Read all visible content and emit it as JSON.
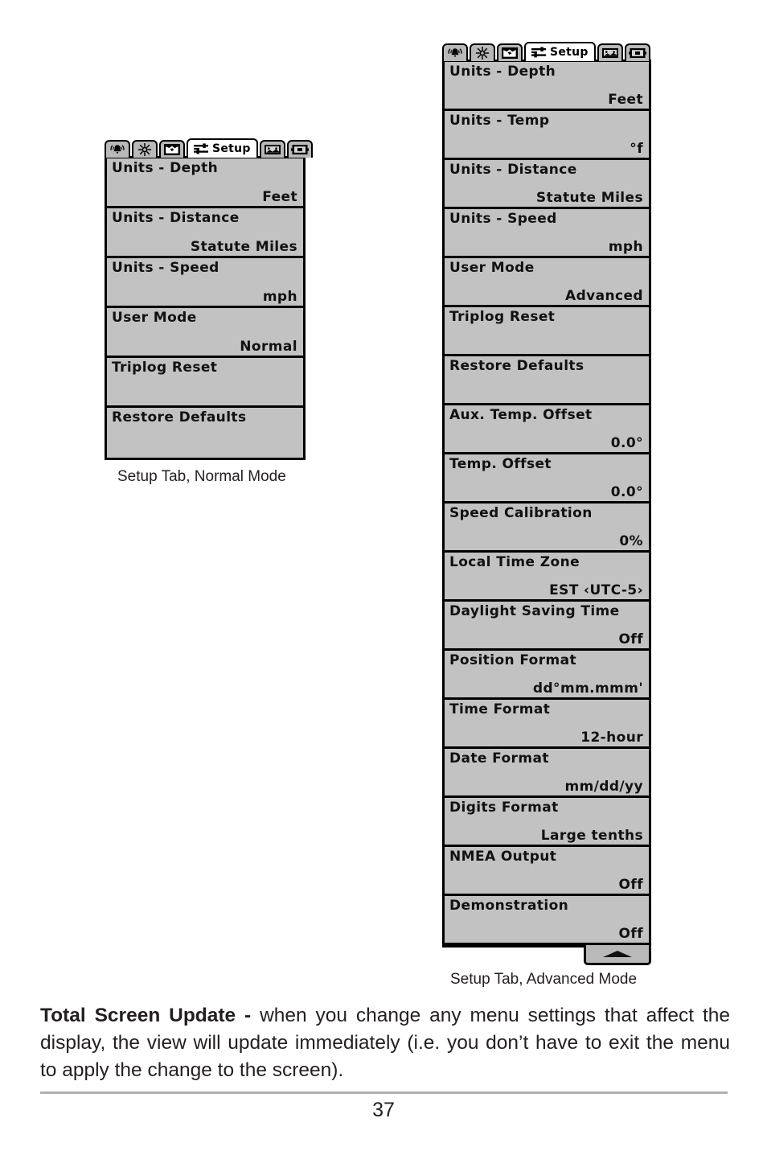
{
  "tab_bar": {
    "tabs": [
      {
        "icon": "alarm-bell-icon",
        "label": "",
        "active": false
      },
      {
        "icon": "sonar-starburst-icon",
        "label": "",
        "active": false
      },
      {
        "icon": "navigation-map-icon",
        "label": "",
        "active": false
      },
      {
        "icon": "setup-sliders-icon",
        "label": "Setup",
        "active": true
      },
      {
        "icon": "views-chart-icon",
        "label": "",
        "active": false
      },
      {
        "icon": "accessories-box-icon",
        "label": "",
        "active": false
      }
    ]
  },
  "normal_panel": {
    "caption": "Setup Tab, Normal Mode",
    "rows": [
      {
        "label": "Units - Depth",
        "value": "Feet"
      },
      {
        "label": "Units - Distance",
        "value": "Statute Miles"
      },
      {
        "label": "Units - Speed",
        "value": "mph"
      },
      {
        "label": "User Mode",
        "value": "Normal"
      },
      {
        "label": "Triplog Reset",
        "value": ""
      },
      {
        "label": "Restore Defaults",
        "value": ""
      }
    ]
  },
  "advanced_panel": {
    "caption": "Setup Tab, Advanced Mode",
    "scroll_indicator": "scroll-up-arrow-icon",
    "rows": [
      {
        "label": "Units - Depth",
        "value": "Feet"
      },
      {
        "label": "Units - Temp",
        "value": "°f"
      },
      {
        "label": "Units - Distance",
        "value": "Statute Miles"
      },
      {
        "label": "Units - Speed",
        "value": "mph"
      },
      {
        "label": "User Mode",
        "value": "Advanced"
      },
      {
        "label": "Triplog Reset",
        "value": ""
      },
      {
        "label": "Restore Defaults",
        "value": ""
      },
      {
        "label": "Aux. Temp. Offset",
        "value": "0.0°"
      },
      {
        "label": "Temp. Offset",
        "value": "0.0°"
      },
      {
        "label": "Speed Calibration",
        "value": "0%"
      },
      {
        "label": "Local Time Zone",
        "value": "EST ‹UTC-5›"
      },
      {
        "label": "Daylight Saving Time",
        "value": "Off"
      },
      {
        "label": "Position Format",
        "value": "dd°mm.mmm'"
      },
      {
        "label": "Time Format",
        "value": "12-hour"
      },
      {
        "label": "Date Format",
        "value": "mm/dd/yy"
      },
      {
        "label": "Digits Format",
        "value": "Large tenths"
      },
      {
        "label": "NMEA Output",
        "value": "Off"
      },
      {
        "label": "Demonstration",
        "value": "Off"
      }
    ]
  },
  "body": {
    "lead": "Total Screen Update - ",
    "text": "when you change any menu settings that affect the display, the view will update immediately (i.e. you don’t have to exit the menu to apply the change to the screen)."
  },
  "footer": {
    "page_number": "37"
  },
  "colors": {
    "lcd_background": "#c2c2c2",
    "tab_inactive": "#b9b9b9",
    "tab_active": "#ffffff",
    "ink": "#000000",
    "page_text": "#231f20"
  }
}
